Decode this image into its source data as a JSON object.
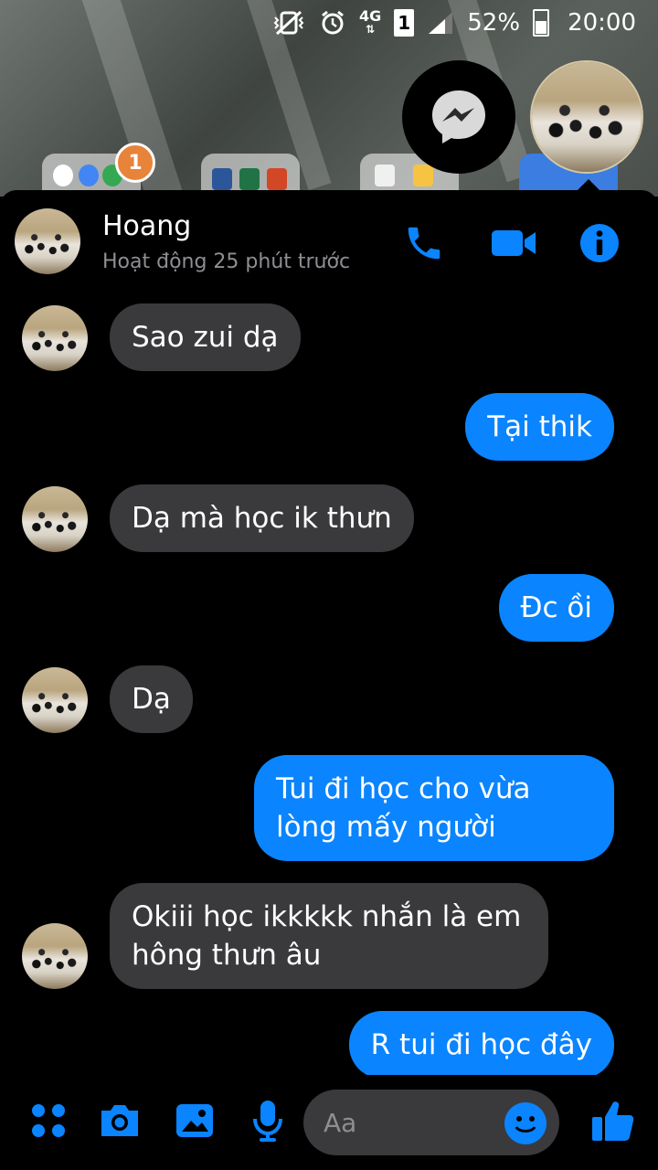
{
  "status_bar": {
    "network_label": "4G",
    "sim_label": "1",
    "battery_percent": "52%",
    "battery_level": 0.52,
    "time": "20:00"
  },
  "homescreen": {
    "notification_badge": "1"
  },
  "chat": {
    "contact_name": "Hoang",
    "contact_status": "Hoạt động 25 phút trước",
    "messages": [
      {
        "from": "contact",
        "text": "Sao zui dạ"
      },
      {
        "from": "me",
        "text": "Tại thik"
      },
      {
        "from": "contact",
        "text": "Dạ mà học ik thưn"
      },
      {
        "from": "me",
        "text": "Đc ồi"
      },
      {
        "from": "contact",
        "text": "Dạ"
      },
      {
        "from": "me",
        "text": "Tui đi học cho vừa lòng mấy người"
      },
      {
        "from": "contact",
        "text": "Okiii học ikkkkk nhắn là em hông thưn âu"
      },
      {
        "from": "me",
        "text": "R tui đi học đây"
      }
    ]
  },
  "composer": {
    "input_placeholder": "Aa"
  },
  "colors": {
    "accent": "#0a84ff",
    "incoming_bubble": "#3a3a3c",
    "background": "#000000",
    "secondary_text": "#8e8e93"
  },
  "icons": {
    "header": [
      "phone-icon",
      "video-camera-icon",
      "info-icon"
    ],
    "composer": [
      "apps-grid-icon",
      "camera-icon",
      "gallery-icon",
      "microphone-icon",
      "emoji-icon",
      "thumbs-up-icon"
    ]
  }
}
